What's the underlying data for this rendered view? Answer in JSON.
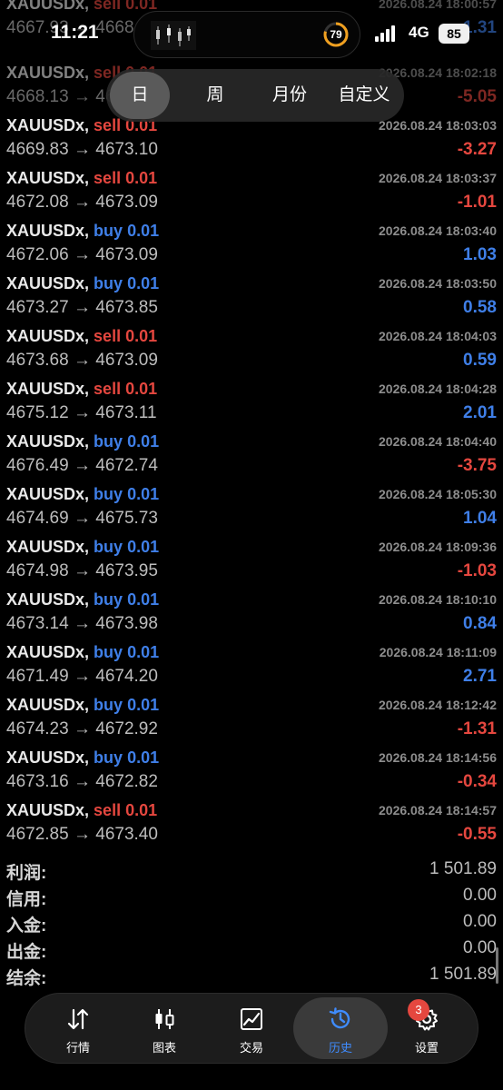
{
  "status_bar": {
    "time": "11:21",
    "network": "4G",
    "battery": "85",
    "island_badge": "79"
  },
  "period_tabs": [
    {
      "label": "日",
      "active": true
    },
    {
      "label": "周",
      "active": false
    },
    {
      "label": "月份",
      "active": false
    },
    {
      "label": "自定义",
      "active": false
    }
  ],
  "trades": [
    {
      "symbol": "XAUUSDx",
      "side": "sell",
      "volume": "0.01",
      "time": "2026.08.24 18:00:57",
      "open": "4667.93",
      "close": "4668.",
      "profit": "1.31",
      "partial": true
    },
    {
      "symbol": "XAUUSDx",
      "side": "sell",
      "volume": "0.01",
      "time": "2026.08.24 18:02:18",
      "open": "4668.13",
      "close": "4673.18",
      "profit": "-5.05",
      "partial": true
    },
    {
      "symbol": "XAUUSDx",
      "side": "sell",
      "volume": "0.01",
      "time": "2026.08.24 18:03:03",
      "open": "4669.83",
      "close": "4673.10",
      "profit": "-3.27"
    },
    {
      "symbol": "XAUUSDx",
      "side": "sell",
      "volume": "0.01",
      "time": "2026.08.24 18:03:37",
      "open": "4672.08",
      "close": "4673.09",
      "profit": "-1.01"
    },
    {
      "symbol": "XAUUSDx",
      "side": "buy",
      "volume": "0.01",
      "time": "2026.08.24 18:03:40",
      "open": "4672.06",
      "close": "4673.09",
      "profit": "1.03"
    },
    {
      "symbol": "XAUUSDx",
      "side": "buy",
      "volume": "0.01",
      "time": "2026.08.24 18:03:50",
      "open": "4673.27",
      "close": "4673.85",
      "profit": "0.58"
    },
    {
      "symbol": "XAUUSDx",
      "side": "sell",
      "volume": "0.01",
      "time": "2026.08.24 18:04:03",
      "open": "4673.68",
      "close": "4673.09",
      "profit": "0.59"
    },
    {
      "symbol": "XAUUSDx",
      "side": "sell",
      "volume": "0.01",
      "time": "2026.08.24 18:04:28",
      "open": "4675.12",
      "close": "4673.11",
      "profit": "2.01"
    },
    {
      "symbol": "XAUUSDx",
      "side": "buy",
      "volume": "0.01",
      "time": "2026.08.24 18:04:40",
      "open": "4676.49",
      "close": "4672.74",
      "profit": "-3.75"
    },
    {
      "symbol": "XAUUSDx",
      "side": "buy",
      "volume": "0.01",
      "time": "2026.08.24 18:05:30",
      "open": "4674.69",
      "close": "4675.73",
      "profit": "1.04"
    },
    {
      "symbol": "XAUUSDx",
      "side": "buy",
      "volume": "0.01",
      "time": "2026.08.24 18:09:36",
      "open": "4674.98",
      "close": "4673.95",
      "profit": "-1.03"
    },
    {
      "symbol": "XAUUSDx",
      "side": "buy",
      "volume": "0.01",
      "time": "2026.08.24 18:10:10",
      "open": "4673.14",
      "close": "4673.98",
      "profit": "0.84"
    },
    {
      "symbol": "XAUUSDx",
      "side": "buy",
      "volume": "0.01",
      "time": "2026.08.24 18:11:09",
      "open": "4671.49",
      "close": "4674.20",
      "profit": "2.71"
    },
    {
      "symbol": "XAUUSDx",
      "side": "buy",
      "volume": "0.01",
      "time": "2026.08.24 18:12:42",
      "open": "4674.23",
      "close": "4672.92",
      "profit": "-1.31"
    },
    {
      "symbol": "XAUUSDx",
      "side": "buy",
      "volume": "0.01",
      "time": "2026.08.24 18:14:56",
      "open": "4673.16",
      "close": "4672.82",
      "profit": "-0.34"
    },
    {
      "symbol": "XAUUSDx",
      "side": "sell",
      "volume": "0.01",
      "time": "2026.08.24 18:14:57",
      "open": "4672.85",
      "close": "4673.40",
      "profit": "-0.55"
    }
  ],
  "summary": [
    {
      "label": "利润:",
      "value": "1 501.89"
    },
    {
      "label": "信用:",
      "value": "0.00"
    },
    {
      "label": "入金:",
      "value": "0.00"
    },
    {
      "label": "出金:",
      "value": "0.00"
    },
    {
      "label": "结余:",
      "value": "1 501.89"
    }
  ],
  "bottom_nav": [
    {
      "label": "行情",
      "icon": "arrows-updown-icon",
      "active": false
    },
    {
      "label": "图表",
      "icon": "candlestick-icon",
      "active": false
    },
    {
      "label": "交易",
      "icon": "trade-chart-icon",
      "active": false
    },
    {
      "label": "历史",
      "icon": "history-clock-icon",
      "active": true
    },
    {
      "label": "设置",
      "icon": "gear-icon",
      "active": false
    }
  ],
  "settings_badge": "3",
  "colors": {
    "sell": "#e5473f",
    "buy": "#3f7fe8",
    "negative": "#e5473f",
    "positive": "#3f7fe8",
    "active_nav": "#3f8cff"
  }
}
